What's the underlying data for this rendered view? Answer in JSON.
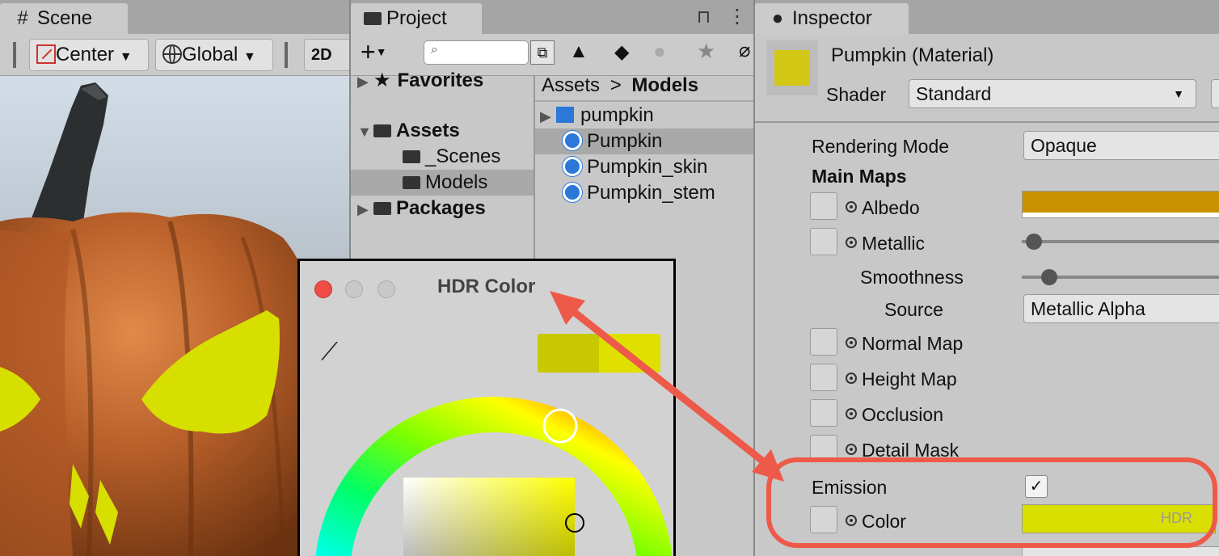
{
  "scene": {
    "tab_label": "Scene",
    "center_label": "Center",
    "global_label": "Global",
    "mode_2d": "2D"
  },
  "project": {
    "tab_label": "Project",
    "favorites": "Favorites",
    "assets": "Assets",
    "scenes_folder": "_Scenes",
    "models_folder": "Models",
    "packages": "Packages",
    "breadcrumb_root": "Assets",
    "breadcrumb_sep": ">",
    "breadcrumb_current": "Models",
    "items": [
      "pumpkin",
      "Pumpkin",
      "Pumpkin_skin",
      "Pumpkin_stem"
    ]
  },
  "inspector": {
    "tab_label": "Inspector",
    "title": "Pumpkin (Material)",
    "shader_label": "Shader",
    "shader_value": "Standard",
    "rendering_mode_label": "Rendering Mode",
    "rendering_mode_value": "Opaque",
    "main_maps": "Main Maps",
    "albedo": "Albedo",
    "metallic": "Metallic",
    "smoothness": "Smoothness",
    "source_label": "Source",
    "source_value": "Metallic Alpha",
    "normal_map": "Normal Map",
    "height_map": "Height Map",
    "occlusion": "Occlusion",
    "detail_mask": "Detail Mask",
    "emission": "Emission",
    "color": "Color",
    "hdr_badge": "HDR",
    "metallic_level": 0.02,
    "smoothness_level": 0.1,
    "albedo_color": "#c99000",
    "emission_color": "#d9df00"
  },
  "hdr_dialog": {
    "title": "HDR Color",
    "swatch_old": "#c8c800",
    "swatch_new": "#dfe000"
  }
}
